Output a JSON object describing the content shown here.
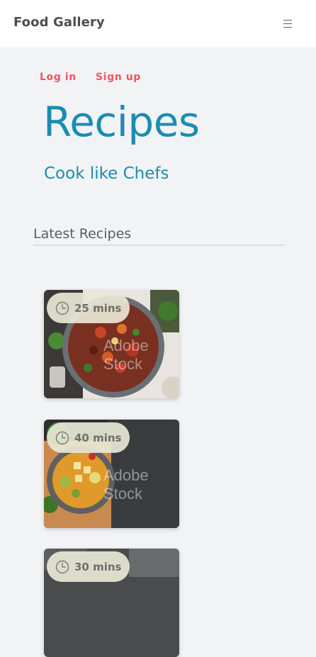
{
  "navbar": {
    "brand": "Food Gallery",
    "menu_icon": "hamburger-menu-icon"
  },
  "auth": {
    "login": "Log in",
    "signup": "Sign up"
  },
  "hero": {
    "title": "Recipes",
    "subtitle": "Cook like Chefs"
  },
  "section": {
    "title": "Latest Recipes"
  },
  "recipes": [
    {
      "time": "25 mins",
      "watermark": "Adobe Stock",
      "icon": "clock-icon"
    },
    {
      "time": "40 mins",
      "watermark": "Adobe Stock",
      "icon": "clock-icon"
    },
    {
      "time": "30 mins",
      "watermark": "",
      "icon": "clock-icon"
    }
  ],
  "colors": {
    "accent": "#1a8db2",
    "auth": "#ef5561",
    "background": "#f2f3f5"
  }
}
